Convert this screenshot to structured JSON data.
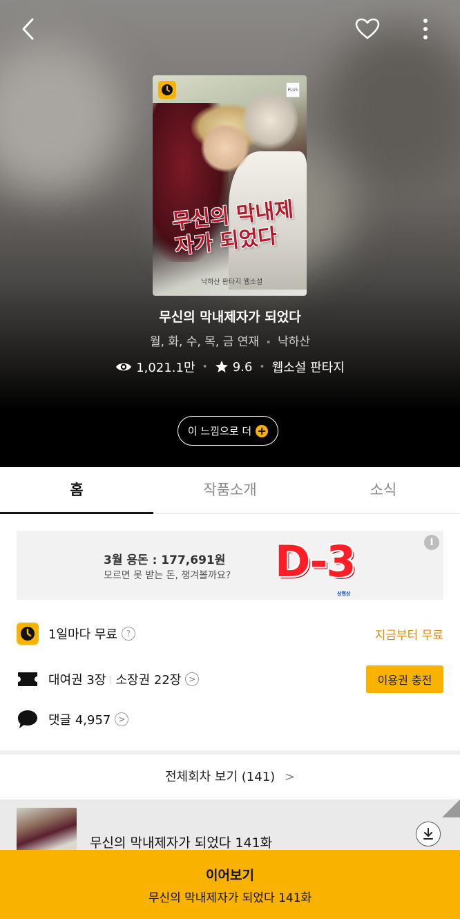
{
  "header": {
    "back_icon": "chevron-left-icon",
    "like_icon": "heart-icon",
    "more_icon": "more-vertical-icon"
  },
  "cover": {
    "cover_title_text": "무신의 막내제자가 되었다",
    "cover_author_text": "낙하산 판타지 웹소설",
    "plus_badge": "PLUS"
  },
  "work": {
    "title": "무신의 막내제자가 되었다",
    "schedule": "월, 화, 수, 목, 금 연재",
    "author": "낙하산",
    "views": "1,021.1만",
    "rating": "9.6",
    "genre": "웹소설 판타지",
    "feel_button": "이 느낌으로 더"
  },
  "tabs": [
    {
      "label": "홈",
      "active": true
    },
    {
      "label": "작품소개",
      "active": false
    },
    {
      "label": "소식",
      "active": false
    }
  ],
  "banner": {
    "title": "3월 용돈 : 177,691원",
    "subtitle": "모르면 못 받는 돈, 챙겨볼까요?",
    "badge": "D-3",
    "brand": "삼쩜삼"
  },
  "info": {
    "free_label": "1일마다 무료",
    "free_action": "지금부터 무료",
    "rental_label": "대여권 3장",
    "own_label": "소장권 22장",
    "charge_button": "이용권 충전",
    "comments_label": "댓글 4,957"
  },
  "episodes": {
    "all_label": "전체회차 보기 (141)",
    "latest_title": "무신의 막내제자가 되었다 141화"
  },
  "bottom": {
    "continue_label": "이어보기",
    "continue_episode": "무신의 막내제자가 되었다 141화"
  },
  "colors": {
    "accent": "#f9b200",
    "orange_text": "#e08a00",
    "badge_red": "#ff1e26"
  }
}
